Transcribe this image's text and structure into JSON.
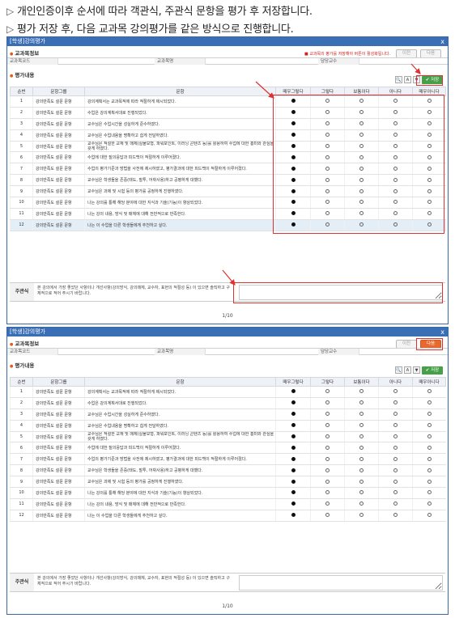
{
  "instructions": [
    "개인인증이후 순서에 따라 객관식, 주관식 문항을 평가 후 저장합니다.",
    "평가 저장 후, 다음 교과목 강의평가를 같은 방식으로 진행합니다."
  ],
  "window": {
    "title": "[학생]강의평가",
    "close": "x",
    "section_info": "교과목정보",
    "section_eval": "평가내용",
    "notice": "■ 교과목의 평가를 저장해야 버튼이 활성화됩니다.",
    "prev_label": "이전",
    "next_label": "다음",
    "save_label": "✔ 저장",
    "fields": {
      "code_label": "교과목코드",
      "name_label": "교과목명",
      "prof_label": "담당교수"
    },
    "tool_icons": [
      "search-icon",
      "excel-icon",
      "filter-icon"
    ],
    "columns": [
      "순번",
      "문항그룹",
      "문항",
      "매우그렇다",
      "그렇다",
      "보통이다",
      "아니다",
      "매우아니다"
    ],
    "rows": [
      {
        "no": "1",
        "group": "강의만족도 설문 문항",
        "question": "강의계획서는 교과목적에 따라 적절하게 제시되었다."
      },
      {
        "no": "2",
        "group": "강의만족도 설문 문항",
        "question": "수업은 강의계획서대로 진행되었다."
      },
      {
        "no": "3",
        "group": "강의만족도 설문 문항",
        "question": "교수님은 수업시간을 성실하게 준수하였다."
      },
      {
        "no": "4",
        "group": "강의만족도 설문 문항",
        "question": "교수님은 수업내용을 명확하고 쉽게 전달하였다."
      },
      {
        "no": "5",
        "group": "강의만족도 설문 문항",
        "question": "교수님은 적절한 교재 및 매체(실물모형, 파워포인트, 이러닝 콘텐츠 등)를 활용하여 수업에 대한 흥미와 관심을 갖게 하였다."
      },
      {
        "no": "6",
        "group": "강의만족도 설문 문항",
        "question": "수업에 대한 질의응답과 피드백이 적절하게 이루어졌다."
      },
      {
        "no": "7",
        "group": "강의만족도 설문 문항",
        "question": "수업의 평가기준과 방법을 사전에 제시하였고, 평가결과에 대한 피드백이 적절하게 이루어졌다."
      },
      {
        "no": "8",
        "group": "강의만족도 설문 문항",
        "question": "교수님은 학생들을 존중(태도, 말투, 어휘사용)하고 공평하게 대했다."
      },
      {
        "no": "9",
        "group": "강의만족도 설문 문항",
        "question": "교수님은 과제 및 시험 등의 평가를 공정하게 진행하였다."
      },
      {
        "no": "10",
        "group": "강의만족도 설문 문항",
        "question": "나는 강의를 통해 해당 분야에 대한 지식과 기술(기능)이 향상되었다."
      },
      {
        "no": "11",
        "group": "강의만족도 설문 문항",
        "question": "나는 강의 내용, 방식 및 매체에 대해 전반적으로 만족한다."
      },
      {
        "no": "12",
        "group": "강의만족도 설문 문항",
        "question": "나는 이 수업을 다른 학생들에게 추천하고 싶다."
      }
    ],
    "selected_choice_index": 0,
    "subjective_label": "주관식",
    "subjective_desc": "본 강의에서 가장 좋았던 사항이나 개선사항(강의방식, 강의매체, 교수자, 표현의 적절성 등) 이 있으면 솔직하고 구체적으로 적어 주시기 바랍니다.",
    "subjective_value": "",
    "page": "1/10"
  },
  "colors": {
    "titlebar": "#3a6eb5",
    "save_button": "#45a047",
    "next_active": "#e8692f",
    "highlight": "#e03030"
  }
}
